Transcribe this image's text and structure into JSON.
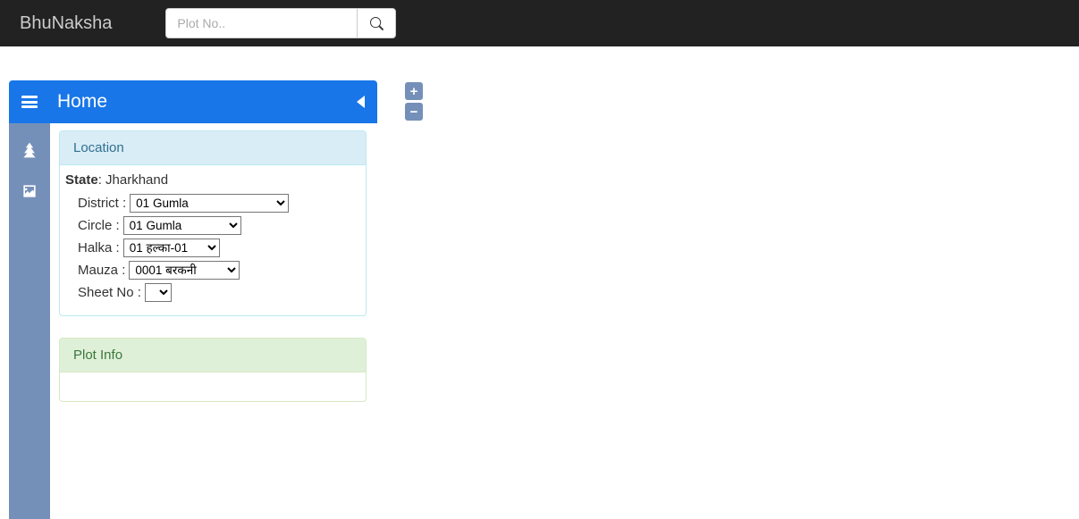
{
  "navbar": {
    "brand": "BhuNaksha",
    "search_placeholder": "Plot No.."
  },
  "header": {
    "title": "Home"
  },
  "location_panel": {
    "heading": "Location",
    "state_label": "State",
    "state_value": "Jharkhand",
    "fields": {
      "district": {
        "label": "District :",
        "value": "01 Gumla"
      },
      "circle": {
        "label": "Circle :",
        "value": "01 Gumla"
      },
      "halka": {
        "label": "Halka :",
        "value": "01 हल्का-01"
      },
      "mauza": {
        "label": "Mauza :",
        "value": "0001 बरकनी "
      },
      "sheet": {
        "label": "Sheet No :",
        "value": ""
      }
    }
  },
  "plotinfo_panel": {
    "heading": "Plot Info"
  },
  "zoom": {
    "in": "+",
    "out": "−"
  }
}
